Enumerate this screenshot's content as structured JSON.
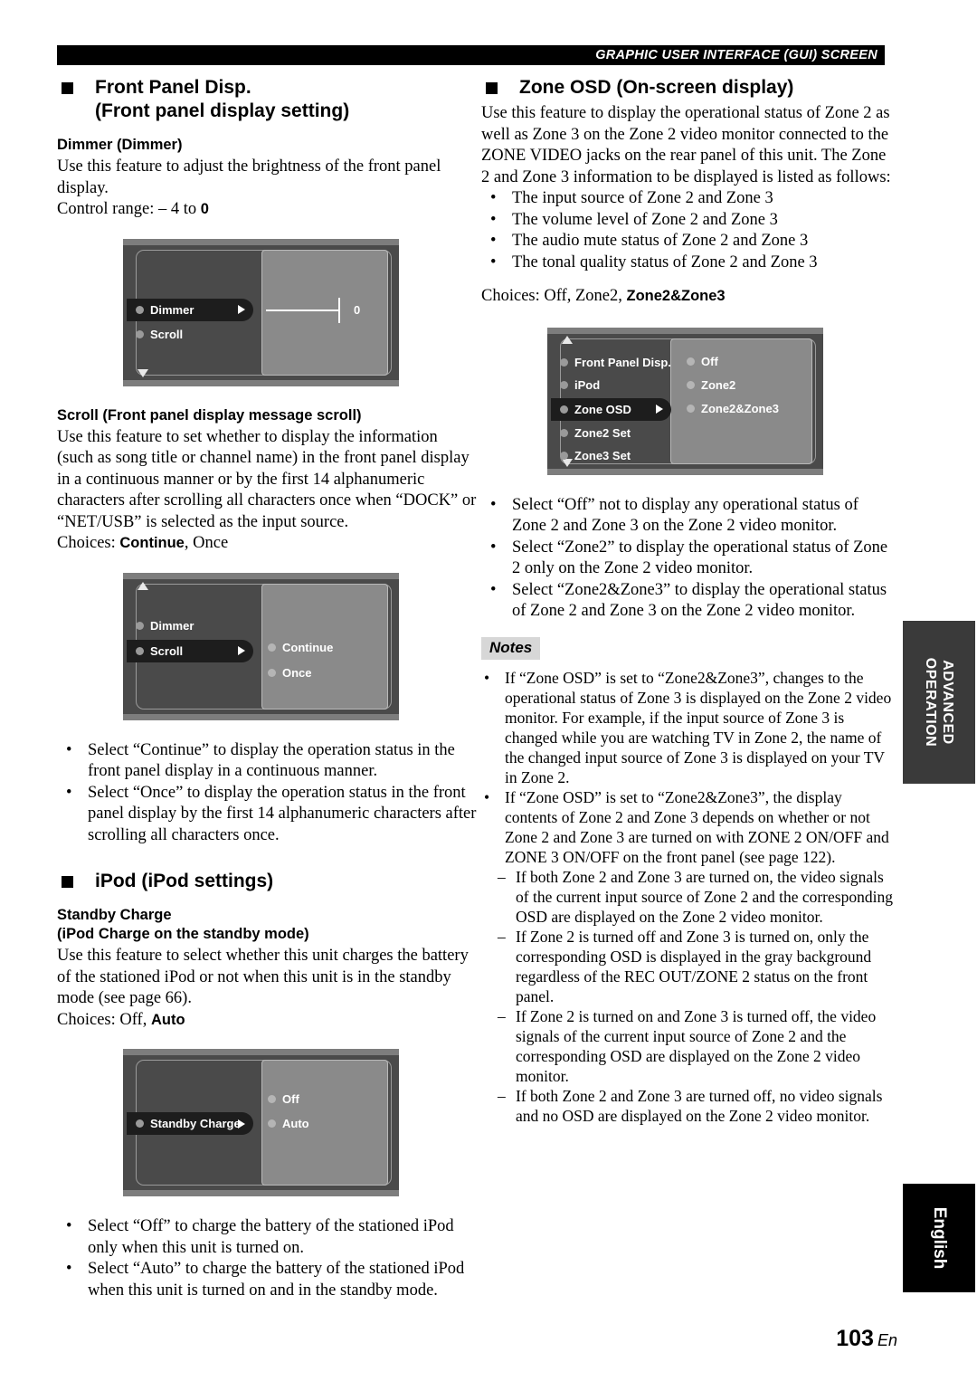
{
  "header": {
    "running_title": "GRAPHIC USER INTERFACE (GUI) SCREEN"
  },
  "left_column": {
    "section1": {
      "title_line1": "Front Panel Disp.",
      "title_line2": "(Front panel display setting)",
      "dimmer": {
        "heading": "Dimmer (Dimmer)",
        "body": "Use this feature to adjust the brightness of the front panel display.",
        "control_range_label": "Control range: – 4 to ",
        "control_range_value": "0"
      },
      "dimmer_gui": {
        "items": [
          {
            "label": "Dimmer",
            "selected": true
          },
          {
            "label": "Scroll",
            "selected": false
          }
        ],
        "slider_value": "0",
        "has_down_arrow": true,
        "has_up_arrow": false
      },
      "scroll": {
        "heading": "Scroll (Front panel display message scroll)",
        "body": "Use this feature to set whether to display the information (such as song title or channel name) in the front panel display in a continuous manner or by the first 14 alphanumeric characters after scrolling all characters once when “DOCK” or “NET/USB” is selected as the input source.",
        "choices_label": "Choices: ",
        "choices_bold": "Continue",
        "choices_rest": ", Once"
      },
      "scroll_gui": {
        "items": [
          {
            "label": "Dimmer",
            "selected": false
          },
          {
            "label": "Scroll",
            "selected": true
          }
        ],
        "options": [
          "Continue",
          "Once"
        ],
        "has_up_arrow": true,
        "has_down_arrow": false
      },
      "bullets": [
        "Select “Continue” to display the operation status in the front panel display in a continuous manner.",
        "Select “Once” to display the operation status in the front panel display by the first 14 alphanumeric characters after scrolling all characters once."
      ]
    },
    "section2": {
      "title_line1": "iPod (iPod settings)",
      "standby": {
        "heading_line1": "Standby Charge",
        "heading_line2": "(iPod Charge on the standby mode)",
        "body": "Use this feature to select whether this unit charges the battery of the stationed iPod or not when this unit is in the standby mode (see page 66).",
        "choices_label": "Choices: Off, ",
        "choices_bold": "Auto"
      },
      "standby_gui": {
        "items": [
          {
            "label": "Standby Charge",
            "selected": true
          }
        ],
        "options": [
          "Off",
          "Auto"
        ],
        "has_up_arrow": false,
        "has_down_arrow": false
      },
      "bullets": [
        "Select “Off” to charge the battery of the stationed iPod only when this unit is turned on.",
        "Select “Auto” to charge the battery of the stationed iPod when this unit is turned on and in the standby mode."
      ]
    }
  },
  "right_column": {
    "section": {
      "title": "Zone OSD (On-screen display)",
      "body": "Use this feature to display the operational status of Zone 2 as well as Zone 3 on the Zone 2 video monitor connected to the ZONE VIDEO jacks on the rear panel of this unit. The Zone 2 and Zone 3 information to be displayed is listed as follows:",
      "info_bullets": [
        "The input source of Zone 2 and Zone 3",
        "The volume level of Zone 2 and Zone 3",
        "The audio mute status of Zone 2 and Zone 3",
        "The tonal quality status of Zone 2 and Zone 3"
      ],
      "choices_label": "Choices: Off, Zone2, ",
      "choices_bold": "Zone2&Zone3",
      "zone_gui": {
        "items": [
          {
            "label": "Front Panel Disp.",
            "selected": false
          },
          {
            "label": "iPod",
            "selected": false
          },
          {
            "label": "Zone OSD",
            "selected": true
          },
          {
            "label": "Zone2 Set",
            "selected": false
          },
          {
            "label": "Zone3 Set",
            "selected": false
          }
        ],
        "options": [
          "Off",
          "Zone2",
          "Zone2&Zone3"
        ],
        "has_up_arrow": true,
        "has_down_arrow": true
      },
      "select_bullets": [
        "Select “Off” not to display any operational status of Zone 2 and Zone 3 on the Zone 2 video monitor.",
        "Select “Zone2” to display the operational status of Zone 2 only on the Zone 2 video monitor.",
        "Select “Zone2&Zone3” to display the operational status of Zone 2 and Zone 3 on the Zone 2 video monitor."
      ]
    },
    "notes": {
      "label": "Notes",
      "items": [
        "If “Zone OSD” is set to “Zone2&Zone3”, changes to the operational status of Zone 3 is displayed on the Zone 2 video monitor. For example, if the input source of Zone 3 is changed while you are watching TV in Zone 2, the name of the changed input source of Zone 3 is displayed on your TV in Zone 2.",
        "If “Zone OSD” is set to “Zone2&Zone3”, the display contents of Zone 2 and Zone 3 depends on whether or not Zone 2 and Zone 3 are turned on with ZONE 2 ON/OFF and ZONE 3 ON/OFF on the front panel (see page 122)."
      ],
      "sub_items": [
        "If both Zone 2 and Zone 3 are turned on, the video signals of the current input source of Zone 2 and the corresponding OSD are displayed on the Zone 2 video monitor.",
        "If Zone 2 is turned off and Zone 3 is turned on, only the corresponding OSD is displayed in the gray background regardless of the REC OUT/ZONE 2 status on the front panel.",
        "If Zone 2 is turned on and Zone 3 is turned off, the video signals of the current input source of Zone 2 and the corresponding OSD are displayed on the Zone 2 video monitor.",
        "If both Zone 2 and Zone 3 are turned off, no video signals and no OSD are displayed on the Zone 2 video monitor."
      ]
    }
  },
  "side_tabs": {
    "advanced": "ADVANCED\nOPERATION",
    "advanced_line1": "ADVANCED",
    "advanced_line2": "OPERATION",
    "english": "English"
  },
  "footer": {
    "page_number": "103",
    "page_suffix": "En"
  },
  "colors": {
    "gui_frame": "#4a4a4a",
    "gui_bar": "#7d7d7d",
    "gui_right_pane": "#8a8a8a",
    "gui_highlight": "#1d1d1d",
    "notes_tag_bg": "#d7d7d7",
    "advanced_tab": "#3a3a3a",
    "english_tab": "#000000"
  }
}
